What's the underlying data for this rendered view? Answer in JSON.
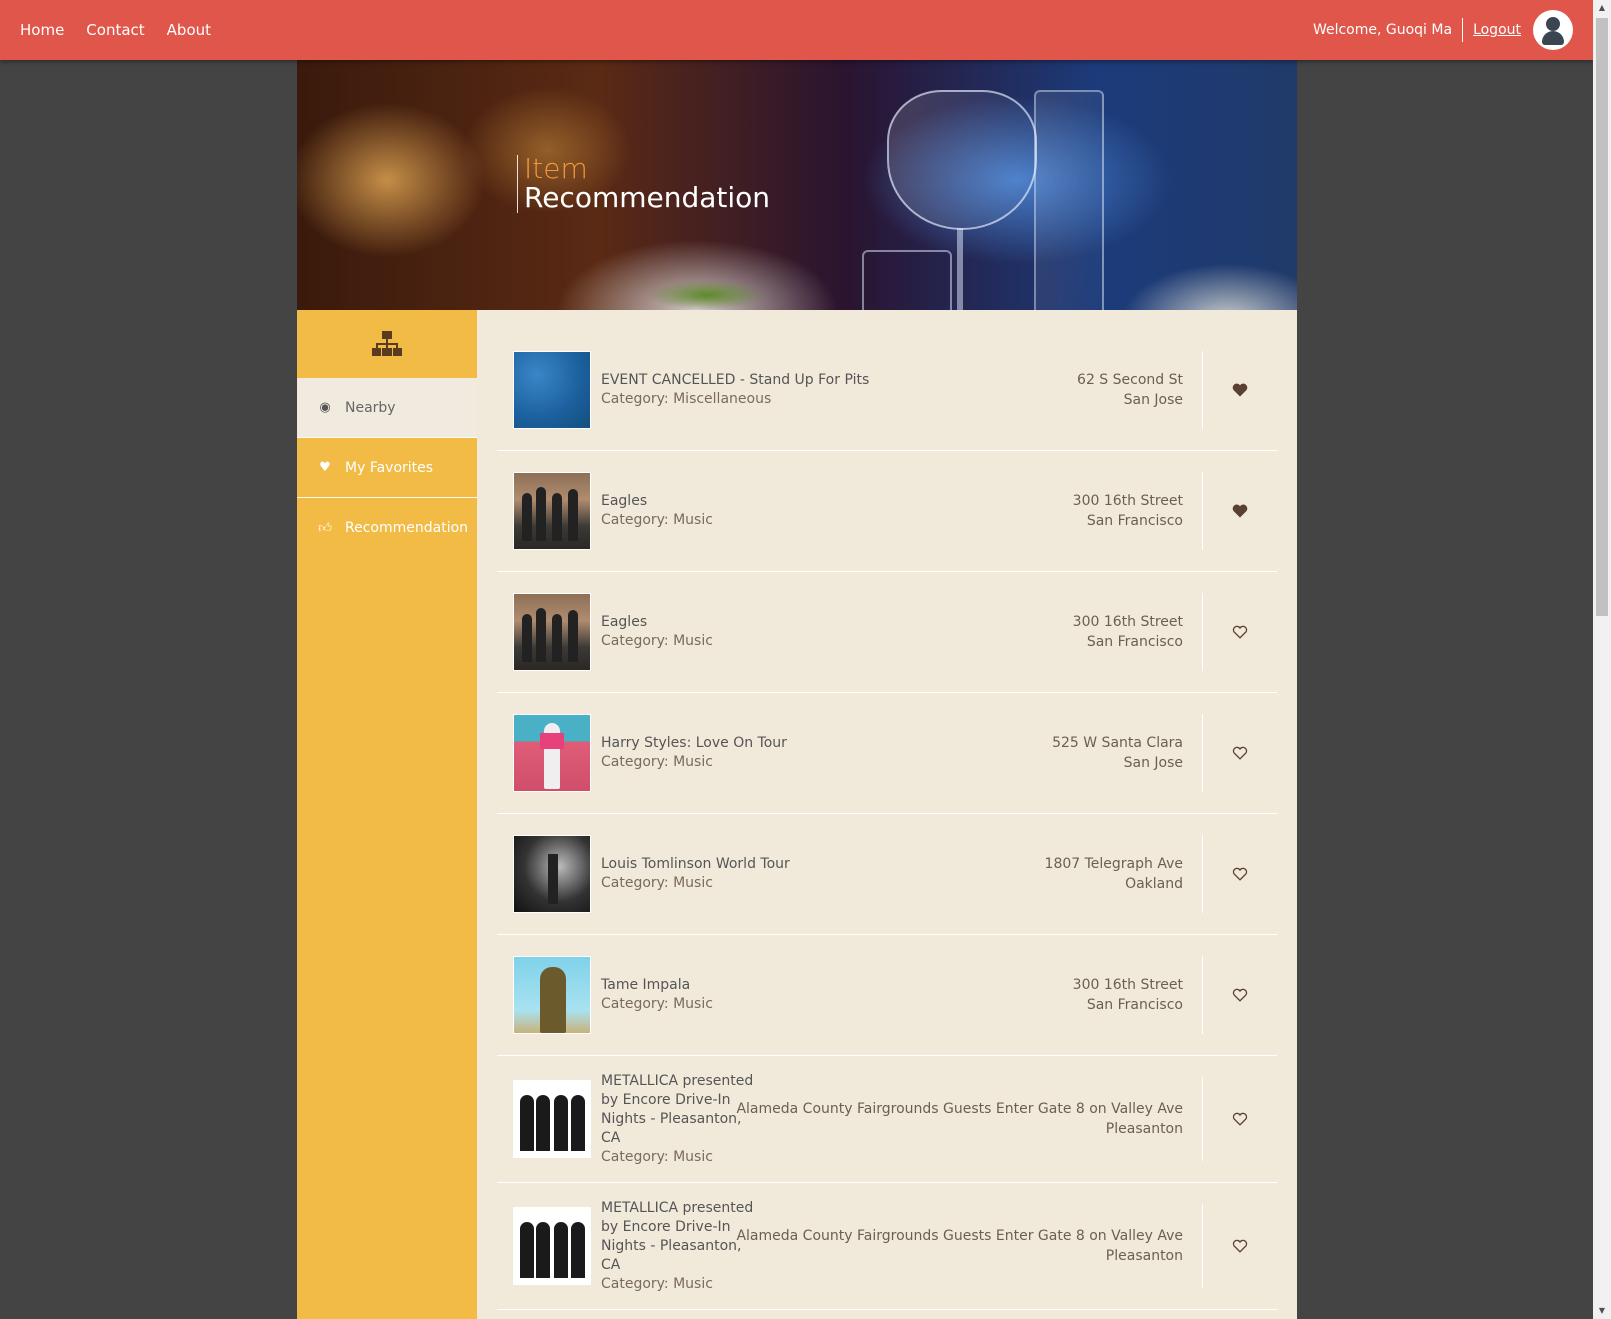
{
  "nav": {
    "links": [
      "Home",
      "Contact",
      "About"
    ],
    "welcome": "Welcome, Guoqi Ma",
    "logout": "Logout"
  },
  "hero": {
    "title_line1": "Item",
    "title_line2": "Recommendation"
  },
  "sidebar": {
    "logo_icon": "sitemap-icon",
    "items": [
      {
        "label": "Nearby",
        "icon": "map-marker-icon",
        "active": true
      },
      {
        "label": "My Favorites",
        "icon": "heart-icon",
        "active": false
      },
      {
        "label": "Recommendation",
        "icon": "thumbs-up-icon",
        "active": false
      }
    ]
  },
  "items": [
    {
      "name": "EVENT CANCELLED - Stand Up For Pits",
      "category": "Category: Miscellaneous",
      "address": "62 S Second St",
      "city": "San Jose",
      "favorite": true,
      "image": "blue"
    },
    {
      "name": "Eagles",
      "category": "Category: Music",
      "address": "300 16th Street",
      "city": "San Francisco",
      "favorite": true,
      "image": "band"
    },
    {
      "name": "Eagles",
      "category": "Category: Music",
      "address": "300 16th Street",
      "city": "San Francisco",
      "favorite": false,
      "image": "band"
    },
    {
      "name": "Harry Styles: Love On Tour",
      "category": "Category: Music",
      "address": "525 W Santa Clara",
      "city": "San Jose",
      "favorite": false,
      "image": "harry"
    },
    {
      "name": "Louis Tomlinson World Tour",
      "category": "Category: Music",
      "address": "1807 Telegraph Ave",
      "city": "Oakland",
      "favorite": false,
      "image": "louis"
    },
    {
      "name": "Tame Impala",
      "category": "Category: Music",
      "address": "300 16th Street",
      "city": "San Francisco",
      "favorite": false,
      "image": "tame"
    },
    {
      "name": "METALLICA presented by Encore Drive-In Nights - Pleasanton, CA",
      "category": "Category: Music",
      "address": "Alameda County Fairgrounds Guests Enter Gate 8 on Valley Ave",
      "city": "Pleasanton",
      "favorite": false,
      "image": "metal"
    },
    {
      "name": "METALLICA presented by Encore Drive-In Nights - Pleasanton, CA",
      "category": "Category: Music",
      "address": "Alameda County Fairgrounds Guests Enter Gate 8 on Valley Ave",
      "city": "Pleasanton",
      "favorite": false,
      "image": "metal"
    }
  ],
  "colors": {
    "nav": "#e0564b",
    "sidebar": "#f2bb45",
    "main": "#f1eadb",
    "background": "#444444"
  }
}
